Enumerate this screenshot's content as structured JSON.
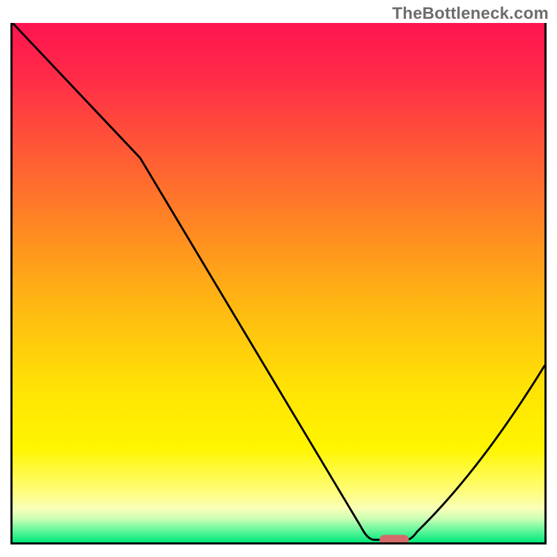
{
  "watermark": "TheBottleneck.com",
  "colors": {
    "gradient_stops": [
      {
        "offset": 0.0,
        "color": "#ff1450"
      },
      {
        "offset": 0.1,
        "color": "#ff2a48"
      },
      {
        "offset": 0.25,
        "color": "#ff5a35"
      },
      {
        "offset": 0.4,
        "color": "#ff8a22"
      },
      {
        "offset": 0.55,
        "color": "#ffba12"
      },
      {
        "offset": 0.7,
        "color": "#ffe205"
      },
      {
        "offset": 0.82,
        "color": "#fff600"
      },
      {
        "offset": 0.9,
        "color": "#fffd78"
      },
      {
        "offset": 0.935,
        "color": "#f9ffb8"
      },
      {
        "offset": 0.955,
        "color": "#c8ffb4"
      },
      {
        "offset": 0.975,
        "color": "#6cf79e"
      },
      {
        "offset": 1.0,
        "color": "#00e87a"
      }
    ],
    "curve_stroke": "#000000",
    "marker_fill": "#d46a6a"
  },
  "chart_data": {
    "type": "line",
    "title": "",
    "xlabel": "",
    "ylabel": "",
    "xlim": [
      0,
      100
    ],
    "ylim": [
      0,
      100
    ],
    "curve": [
      {
        "x": 0.0,
        "y": 100.0
      },
      {
        "x": 24.0,
        "y": 74.0
      },
      {
        "x": 65.5,
        "y": 3.0
      },
      {
        "x": 68.0,
        "y": 0.5
      },
      {
        "x": 74.0,
        "y": 0.5
      },
      {
        "x": 76.0,
        "y": 2.0
      },
      {
        "x": 100.0,
        "y": 34.0
      }
    ],
    "right_curve_control": {
      "x": 88.0,
      "y": 14.0
    },
    "marker": {
      "x_start": 69.0,
      "x_end": 74.5,
      "y": 0.5
    },
    "annotations": []
  }
}
